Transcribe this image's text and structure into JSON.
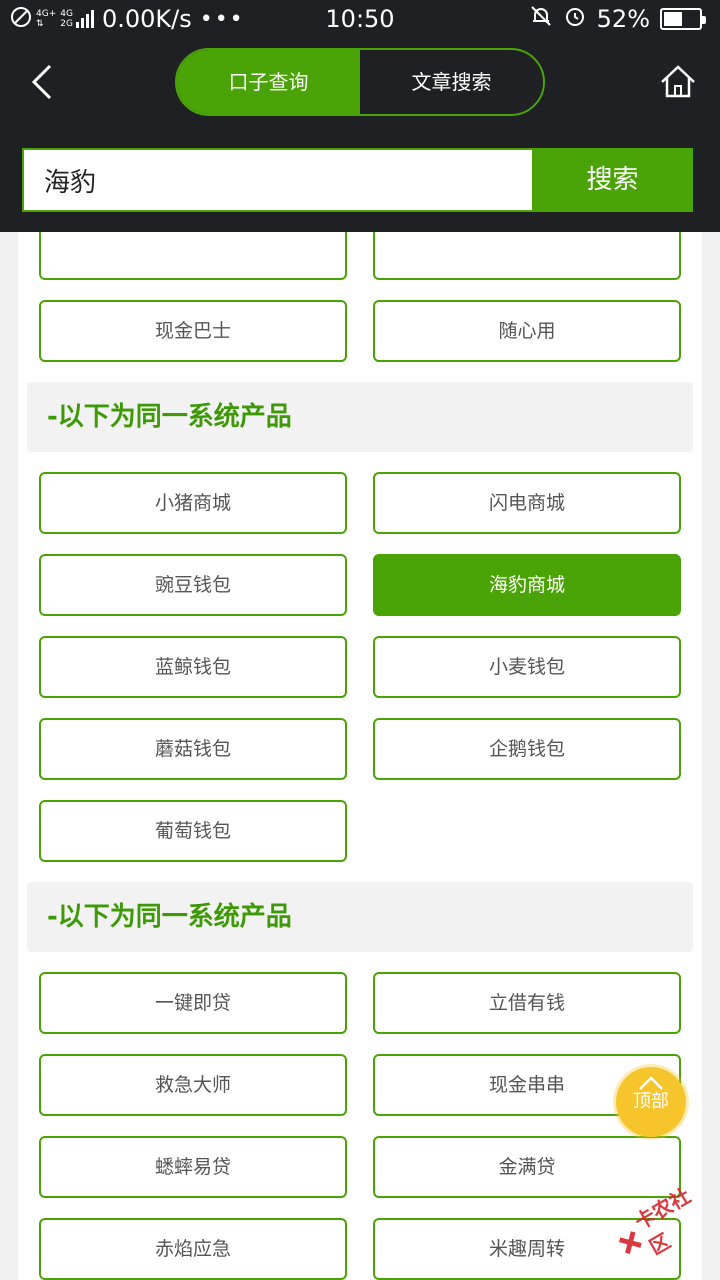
{
  "status_bar": {
    "net1": "4G+",
    "net2": "4G",
    "net3": "2G",
    "speed": "0.00K/s",
    "more": "•••",
    "time": "10:50",
    "battery": "52%",
    "battery_level": 0.52
  },
  "header": {
    "tabs": [
      {
        "label": "口子查询",
        "active": true
      },
      {
        "label": "文章搜索",
        "active": false
      }
    ]
  },
  "search": {
    "value": "海豹",
    "button_label": "搜索"
  },
  "partial_row": [
    "",
    ""
  ],
  "group0": [
    "现金巴士",
    "随心用"
  ],
  "section1": {
    "title": "-以下为同一系统产品",
    "items": [
      "小猪商城",
      "闪电商城",
      "豌豆钱包",
      "海豹商城",
      "蓝鲸钱包",
      "小麦钱包",
      "蘑菇钱包",
      "企鹅钱包",
      "葡萄钱包"
    ],
    "selected": "海豹商城"
  },
  "section2": {
    "title": "-以下为同一系统产品",
    "items": [
      "一键即贷",
      "立借有钱",
      "救急大师",
      "现金串串",
      "蟋蟀易贷",
      "金满贷",
      "赤焰应急",
      "米趣周转"
    ]
  },
  "top_button": {
    "label": "顶部"
  },
  "watermark": {
    "text": "卡农社区"
  },
  "colors": {
    "accent": "#4aa307",
    "header_bg": "#1e2023",
    "top_button": "#f6c52c"
  }
}
